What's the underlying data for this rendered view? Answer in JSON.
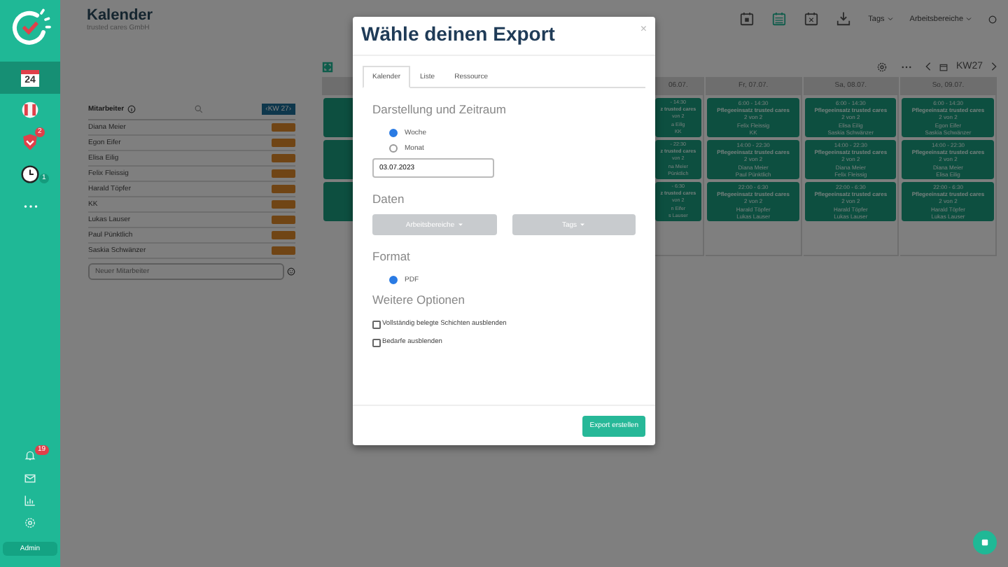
{
  "sidebar": {
    "items": [
      {
        "kind": "calendar",
        "label": "24",
        "selected": true
      },
      {
        "kind": "flag",
        "selected": false
      },
      {
        "kind": "shield",
        "badge": "2",
        "selected": false
      },
      {
        "kind": "clock",
        "badge": "1",
        "selected": false
      },
      {
        "kind": "more",
        "selected": false
      }
    ],
    "bottom_items": [
      {
        "kind": "bell",
        "badge": "19"
      },
      {
        "kind": "mail"
      },
      {
        "kind": "chart"
      },
      {
        "kind": "gear"
      }
    ],
    "user_button": "Admin"
  },
  "header": {
    "title": "Kalender",
    "subtitle": "trusted cares GmbH",
    "views": [
      {
        "kind": "week",
        "selected": false
      },
      {
        "kind": "list",
        "selected": true
      },
      {
        "kind": "day",
        "selected": false
      }
    ],
    "tags_filter": "Tags",
    "areas_filter": "Arbeitsbereiche"
  },
  "calendar_toolbar": {
    "week": "KW27"
  },
  "employees": {
    "heading": "Mitarbeiter",
    "week_button": "‹KW 27›",
    "rows": [
      {
        "name": "Diana Meier"
      },
      {
        "name": "Egon Eifer"
      },
      {
        "name": "Elisa Eilig"
      },
      {
        "name": "Felix Fleissig"
      },
      {
        "name": "Harald Töpfer"
      },
      {
        "name": "KK"
      },
      {
        "name": "Lukas Lauser"
      },
      {
        "name": "Paul Pünktlich"
      },
      {
        "name": "Saskia Schwänzer"
      }
    ],
    "new_placeholder": "Neuer Mitarbeiter"
  },
  "calendar": {
    "days": [
      {
        "kind": "partial",
        "header": "06.07.",
        "shifts": [
          [
            "- 14:30",
            "z trusted cares",
            "von 2",
            "a Eilig",
            "KK"
          ],
          [
            "- 22:30",
            "z trusted cares",
            "von 2",
            "na Meier",
            "Pünktlich"
          ],
          [
            "- 6:30",
            "z trusted cares",
            "von 2",
            "n Eifer",
            "s Lauser"
          ]
        ]
      },
      {
        "kind": "full",
        "header": "Fr, 07.07.",
        "shifts": [
          [
            "6:00 - 14:30",
            "Pflegeeinsatz trusted cares",
            "2 von 2",
            "Felix Fleissig",
            "KK"
          ],
          [
            "14:00 - 22:30",
            "Pflegeeinsatz trusted cares",
            "2 von 2",
            "Diana Meier",
            "Paul Pünktlich"
          ],
          [
            "22:00 - 6:30",
            "Pflegeeinsatz trusted cares",
            "2 von 2",
            "Harald Töpfer",
            "Lukas Lauser"
          ]
        ]
      },
      {
        "kind": "full",
        "header": "Sa, 08.07.",
        "shifts": [
          [
            "6:00 - 14:30",
            "Pflegeeinsatz trusted cares",
            "2 von 2",
            "Elisa Eilig",
            "Saskia Schwänzer"
          ],
          [
            "14:00 - 22:30",
            "Pflegeeinsatz trusted cares",
            "2 von 2",
            "Diana Meier",
            "Felix Fleissig"
          ],
          [
            "22:00 - 6:30",
            "Pflegeeinsatz trusted cares",
            "2 von 2",
            "Harald Töpfer",
            "Lukas Lauser"
          ]
        ]
      },
      {
        "kind": "full",
        "header": "So, 09.07.",
        "shifts": [
          [
            "6:00 - 14:30",
            "Pflegeeinsatz trusted cares",
            "2 von 2",
            "Egon Eifer",
            "Saskia Schwänzer"
          ],
          [
            "14:00 - 22:30",
            "Pflegeeinsatz trusted cares",
            "2 von 2",
            "Diana Meier",
            "Elisa Eilig"
          ],
          [
            "22:00 - 6:30",
            "Pflegeeinsatz trusted cares",
            "2 von 2",
            "Harald Töpfer",
            "Lukas Lauser"
          ]
        ]
      }
    ]
  },
  "modal": {
    "title": "Wähle deinen Export",
    "close": "×",
    "tabs": [
      {
        "label": "Kalender",
        "selected": true
      },
      {
        "label": "Liste",
        "selected": false
      },
      {
        "label": "Ressource",
        "selected": false
      }
    ],
    "period_heading": "Darstellung und Zeitraum",
    "period_options": [
      {
        "label": "Woche",
        "selected": true
      },
      {
        "label": "Monat",
        "selected": false
      }
    ],
    "date": "03.07.2023",
    "data_heading": "Daten",
    "data_buttons": [
      "Arbeitsbereiche",
      "Tags"
    ],
    "format_heading": "Format",
    "format_options": [
      {
        "label": "PDF",
        "selected": true
      }
    ],
    "options_heading": "Weitere Optionen",
    "options": [
      {
        "label": "Vollständig belegte Schichten ausblenden",
        "checked": false
      },
      {
        "label": "Bedarfe ausblenden",
        "checked": false
      }
    ],
    "submit": "Export erstellen"
  }
}
